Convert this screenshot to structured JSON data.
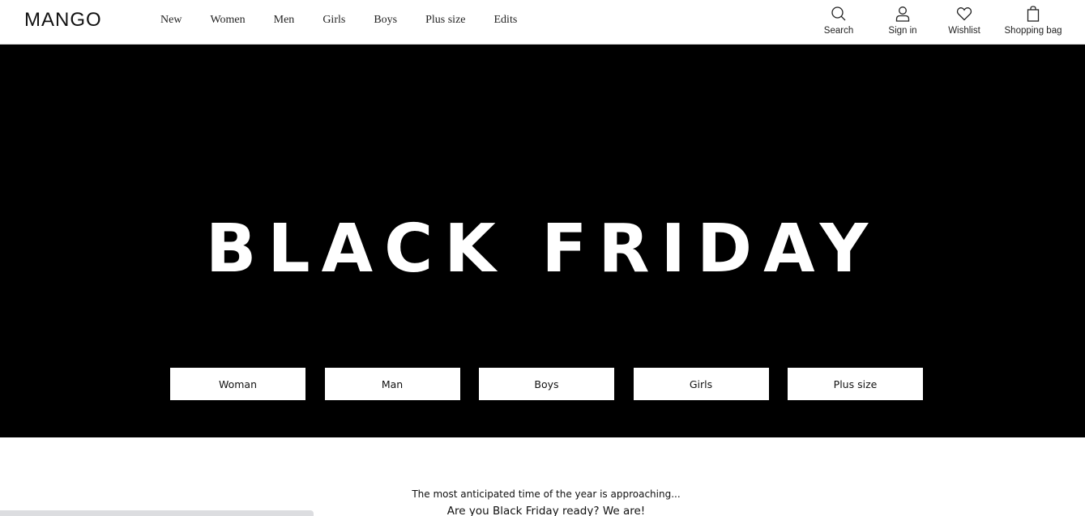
{
  "brand": {
    "logo_text": "MANGO"
  },
  "nav": {
    "items": [
      {
        "label": "New"
      },
      {
        "label": "Women"
      },
      {
        "label": "Men"
      },
      {
        "label": "Girls"
      },
      {
        "label": "Boys"
      },
      {
        "label": "Plus size"
      },
      {
        "label": "Edits"
      }
    ]
  },
  "actions": {
    "search": {
      "label": "Search",
      "icon": "search-icon"
    },
    "signin": {
      "label": "Sign in",
      "icon": "user-icon"
    },
    "wishlist": {
      "label": "Wishlist",
      "icon": "heart-icon"
    },
    "bag": {
      "label": "Shopping bag",
      "icon": "bag-icon"
    }
  },
  "hero": {
    "title": "BLACK FRIDAY",
    "background": "#000000",
    "buttons": [
      {
        "label": "Woman"
      },
      {
        "label": "Man"
      },
      {
        "label": "Boys"
      },
      {
        "label": "Girls"
      },
      {
        "label": "Plus size"
      }
    ]
  },
  "intro": {
    "line1": "The most anticipated time of the year is approaching...",
    "line2": "Are you Black Friday ready? We are!"
  }
}
